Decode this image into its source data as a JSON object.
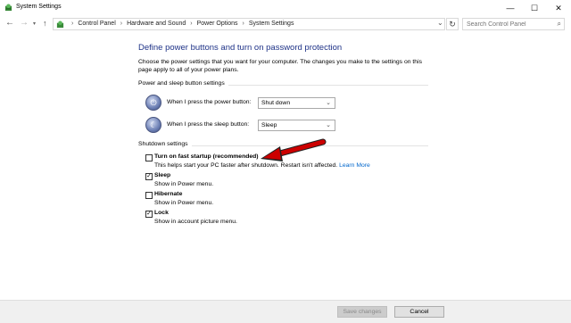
{
  "window": {
    "title": "System Settings",
    "minimize": "—",
    "maximize": "☐",
    "close": "✕"
  },
  "address": {
    "crumbs": [
      "Control Panel",
      "Hardware and Sound",
      "Power Options",
      "System Settings"
    ],
    "search_placeholder": "Search Control Panel"
  },
  "page": {
    "title": "Define power buttons and turn on password protection",
    "intro": "Choose the power settings that you want for your computer. The changes you make to the settings on this page apply to all of your power plans."
  },
  "power_section": {
    "label": "Power and sleep button settings",
    "power_button": {
      "label": "When I press the power button:",
      "value": "Shut down"
    },
    "sleep_button": {
      "label": "When I press the sleep button:",
      "value": "Sleep"
    }
  },
  "shutdown_section": {
    "label": "Shutdown settings",
    "items": [
      {
        "title": "Turn on fast startup (recommended)",
        "desc": "This helps start your PC faster after shutdown. Restart isn't affected.",
        "link": "Learn More",
        "checked": false
      },
      {
        "title": "Sleep",
        "desc": "Show in Power menu.",
        "checked": true
      },
      {
        "title": "Hibernate",
        "desc": "Show in Power menu.",
        "checked": false
      },
      {
        "title": "Lock",
        "desc": "Show in account picture menu.",
        "checked": true
      }
    ]
  },
  "footer": {
    "save_label": "Save changes",
    "cancel_label": "Cancel"
  },
  "colors": {
    "title_blue": "#1e3287",
    "link_blue": "#0066cc",
    "annotation_arrow": "#cc0000"
  }
}
